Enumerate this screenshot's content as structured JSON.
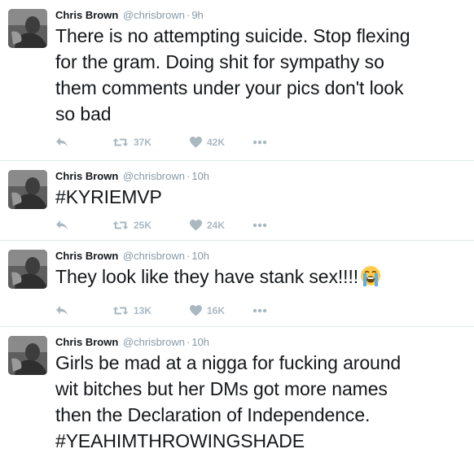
{
  "tweets": [
    {
      "name": "Chris Brown",
      "handle": "@chrisbrown",
      "separator": "·",
      "time": "9h",
      "text": "There is no attempting suicide. Stop flexing\nfor the gram. Doing shit for sympathy so\nthem comments under your pics don't look\nso bad",
      "retweets": "37K",
      "likes": "42K"
    },
    {
      "name": "Chris Brown",
      "handle": "@chrisbrown",
      "separator": "·",
      "time": "10h",
      "text": "#KYRIEMVP",
      "retweets": "25K",
      "likes": "24K"
    },
    {
      "name": "Chris Brown",
      "handle": "@chrisbrown",
      "separator": "·",
      "time": "10h",
      "text": "They look like they have stank sex!!!!",
      "emoji": "loudly-crying-face-emoji",
      "retweets": "13K",
      "likes": "16K"
    },
    {
      "name": "Chris Brown",
      "handle": "@chrisbrown",
      "separator": "·",
      "time": "10h",
      "text": "Girls be mad at a nigga for fucking around\nwit bitches but her DMs got more names\nthen the Declaration of Independence.\n#YEAHIMTHROWINGSHADE"
    }
  ],
  "icons": {
    "reply": "reply-icon",
    "retweet": "retweet-icon",
    "like": "heart-icon",
    "more": "more-dots-icon"
  },
  "colors": {
    "text": "#14171a",
    "secondary": "#8899a6",
    "icon": "#aab8c2",
    "divider": "#e1e8ed"
  }
}
